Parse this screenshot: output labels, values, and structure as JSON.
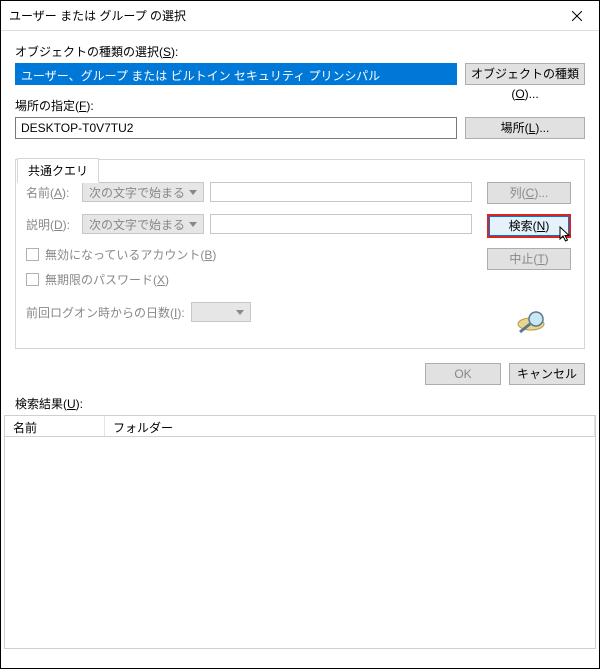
{
  "titlebar": {
    "title": "ユーザー または グループ の選択"
  },
  "objectTypes": {
    "label": "オブジェクトの種類の選択(S):",
    "value": "ユーザー、グループ または ビルトイン セキュリティ プリンシパル",
    "button": "オブジェクトの種類(O)..."
  },
  "location": {
    "label": "場所の指定(F):",
    "value": "DESKTOP-T0V7TU2",
    "button": "場所(L)..."
  },
  "tab": {
    "label": "共通クエリ"
  },
  "query": {
    "nameLabel": "名前(A):",
    "nameMode": "次の文字で始まる",
    "descLabel": "説明(D):",
    "descMode": "次の文字で始まる",
    "disabledAccounts": "無効になっているアカウント(B)",
    "nonExpiringPw": "無期限のパスワード(X)",
    "daysLabel": "前回ログオン時からの日数(I):"
  },
  "sideButtons": {
    "columns": "列(C)...",
    "search": "検索(N)",
    "stop": "中止(T)"
  },
  "bottom": {
    "ok": "OK",
    "cancel": "キャンセル"
  },
  "results": {
    "label": "検索結果(U):",
    "colName": "名前",
    "colFolder": "フォルダー"
  }
}
